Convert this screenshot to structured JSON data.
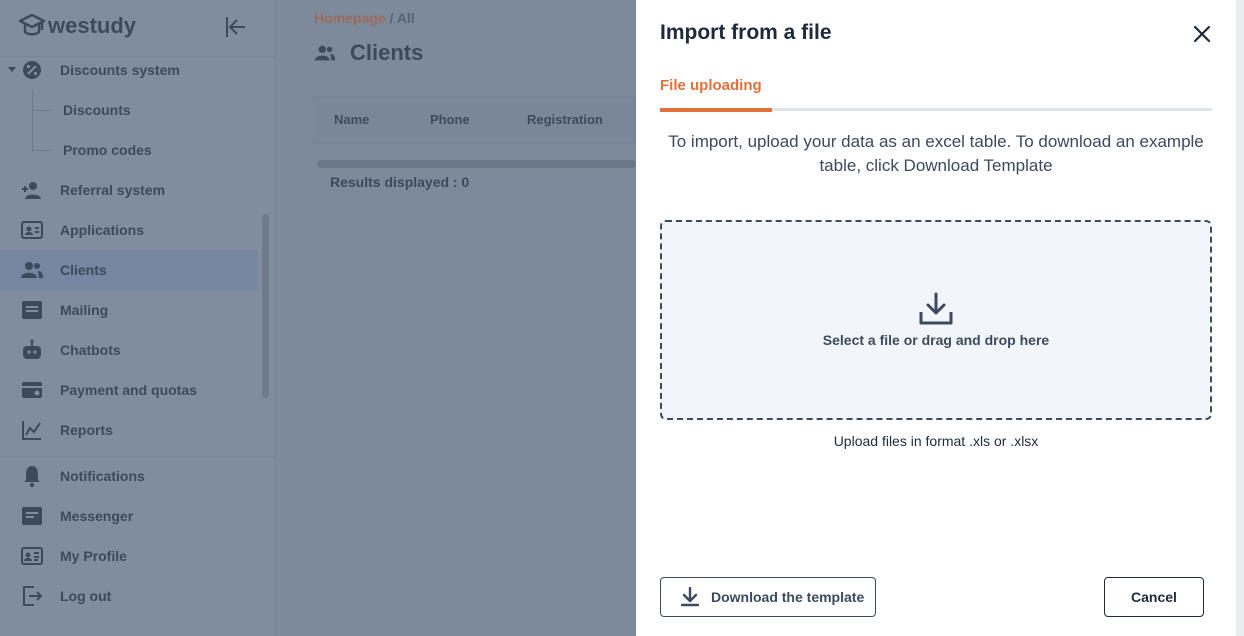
{
  "app": {
    "logo_text": "westudy"
  },
  "sidebar": {
    "items": [
      {
        "label": "Discounts system",
        "icon": "discount-gear-icon"
      },
      {
        "label": "Discounts",
        "icon": ""
      },
      {
        "label": "Promo codes",
        "icon": ""
      },
      {
        "label": "Referral system",
        "icon": "user-plus-icon"
      },
      {
        "label": "Applications",
        "icon": "contact-card-icon"
      },
      {
        "label": "Clients",
        "icon": "users-icon",
        "active": true
      },
      {
        "label": "Mailing",
        "icon": "mail-list-icon"
      },
      {
        "label": "Chatbots",
        "icon": "robot-icon"
      },
      {
        "label": "Payment and quotas",
        "icon": "wallet-icon"
      },
      {
        "label": "Reports",
        "icon": "chart-line-icon"
      },
      {
        "label": "Notifications",
        "icon": "bell-icon"
      },
      {
        "label": "Messenger",
        "icon": "messenger-icon"
      },
      {
        "label": "My Profile",
        "icon": "profile-card-icon"
      },
      {
        "label": "Log out",
        "icon": "logout-icon"
      }
    ]
  },
  "main": {
    "breadcrumb": {
      "home": "Homepage",
      "separator": "/",
      "current": "All"
    },
    "title": "Clients",
    "table_headers": [
      "Name",
      "Phone",
      "Registration"
    ],
    "results_text": "Results displayed : 0"
  },
  "modal": {
    "title": "Import from a file",
    "tab_label": "File uploading",
    "instructions": "To import, upload your data as an excel table. To download an example table, click Download Template",
    "dropzone_text": "Select a file or drag and drop here",
    "format_hint": "Upload files in format .xls or .xlsx",
    "download_button": "Download the template",
    "cancel_button": "Cancel"
  },
  "colors": {
    "accent": "#e2703a",
    "text_dark": "#1e2a3a",
    "text_mid": "#3c4a5e",
    "overlay": "#7d8a9c"
  }
}
